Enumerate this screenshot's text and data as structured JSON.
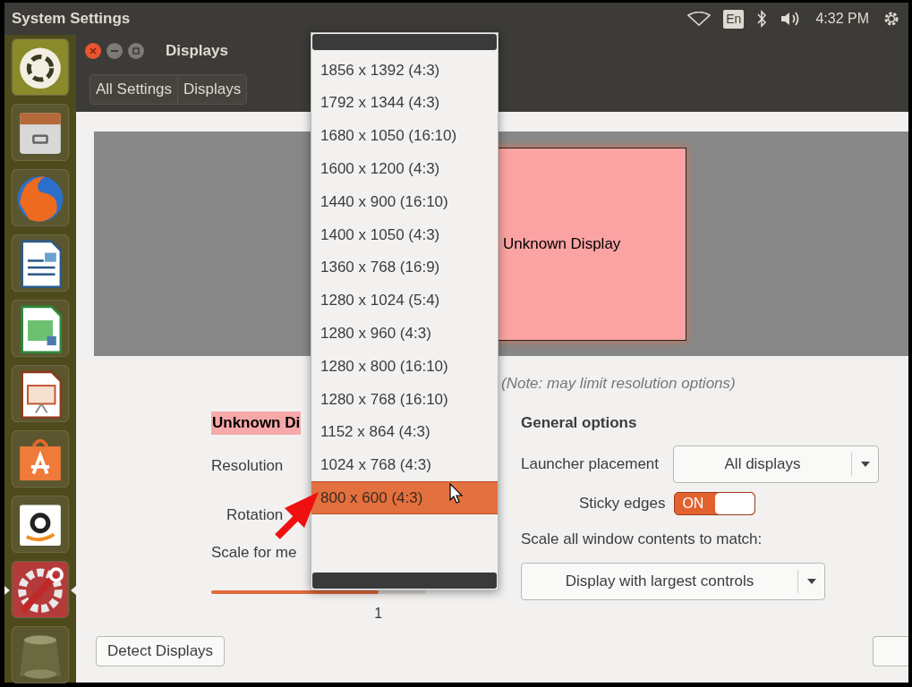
{
  "top_panel": {
    "app_title": "System Settings",
    "keyboard_layout": "En",
    "clock": "4:32 PM"
  },
  "launcher": [
    {
      "kind": "dash",
      "focused": false
    },
    {
      "kind": "files",
      "focused": false
    },
    {
      "kind": "browser",
      "focused": false
    },
    {
      "kind": "writer",
      "focused": false
    },
    {
      "kind": "calc",
      "focused": false
    },
    {
      "kind": "impress",
      "focused": false
    },
    {
      "kind": "store",
      "focused": false
    },
    {
      "kind": "shop",
      "focused": false
    },
    {
      "kind": "settings",
      "focused": true
    },
    {
      "kind": "trash",
      "focused": false
    }
  ],
  "window": {
    "title": "Displays",
    "breadcrumb": [
      "All Settings",
      "Displays"
    ]
  },
  "preview": {
    "monitor_label": "Unknown Display"
  },
  "note": "(Note: may limit resolution options)",
  "display_options": {
    "heading": "Unknown Di",
    "resolution_label": "Resolution",
    "rotation_label": "Rotation",
    "scale_label": "Scale for me",
    "scale_slider": {
      "level": 0.78,
      "reading": "1"
    }
  },
  "general_options": {
    "heading": "General options",
    "launcher_placement": {
      "label": "Launcher placement",
      "value": "All displays"
    },
    "sticky_edges": {
      "label": "Sticky edges",
      "on": true,
      "on_text": "ON"
    },
    "scale_all": {
      "label": "Scale all window contents to match:",
      "value": "Display with largest controls"
    }
  },
  "detect_button": "Detect Displays",
  "resolution_menu": [
    {
      "label": "1856 x 1392 (4:3)",
      "selected": false
    },
    {
      "label": "1792 x 1344 (4:3)",
      "selected": false
    },
    {
      "label": "1680 x 1050 (16:10)",
      "selected": false
    },
    {
      "label": "1600 x 1200 (4:3)",
      "selected": false
    },
    {
      "label": "1440 x 900 (16:10)",
      "selected": false
    },
    {
      "label": "1400 x 1050 (4:3)",
      "selected": false
    },
    {
      "label": "1360 x 768 (16:9)",
      "selected": false
    },
    {
      "label": "1280 x 1024 (5:4)",
      "selected": false
    },
    {
      "label": "1280 x 960 (4:3)",
      "selected": false
    },
    {
      "label": "1280 x 800 (16:10)",
      "selected": false
    },
    {
      "label": "1280 x 768 (16:10)",
      "selected": false
    },
    {
      "label": "1152 x 864 (4:3)",
      "selected": false
    },
    {
      "label": "1024 x 768 (4:3)",
      "selected": false
    },
    {
      "label": "800 x 600 (4:3)",
      "selected": true
    }
  ]
}
